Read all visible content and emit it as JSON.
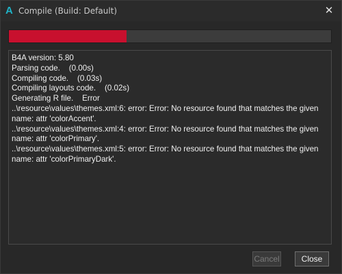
{
  "window": {
    "app_logo": "A",
    "title": "Compile (Build: Default)",
    "close_glyph": "✕"
  },
  "progress": {
    "fraction": 0.365,
    "fill_color": "#c8102e",
    "track_color": "#3c3c3c"
  },
  "log": {
    "lines": [
      "B4A version: 5.80",
      "Parsing code.    (0.00s)",
      "Compiling code.    (0.03s)",
      "Compiling layouts code.    (0.02s)",
      "Generating R file.    Error",
      "..\\resource\\values\\themes.xml:6: error: Error: No resource found that matches the given name: attr 'colorAccent'.",
      "..\\resource\\values\\themes.xml:4: error: Error: No resource found that matches the given name: attr 'colorPrimary'.",
      "..\\resource\\values\\themes.xml:5: error: Error: No resource found that matches the given name: attr 'colorPrimaryDark'."
    ]
  },
  "buttons": {
    "cancel_label": "Cancel",
    "close_label": "Close"
  },
  "icons": {
    "app": "b4a-logo-icon",
    "close": "close-icon"
  }
}
